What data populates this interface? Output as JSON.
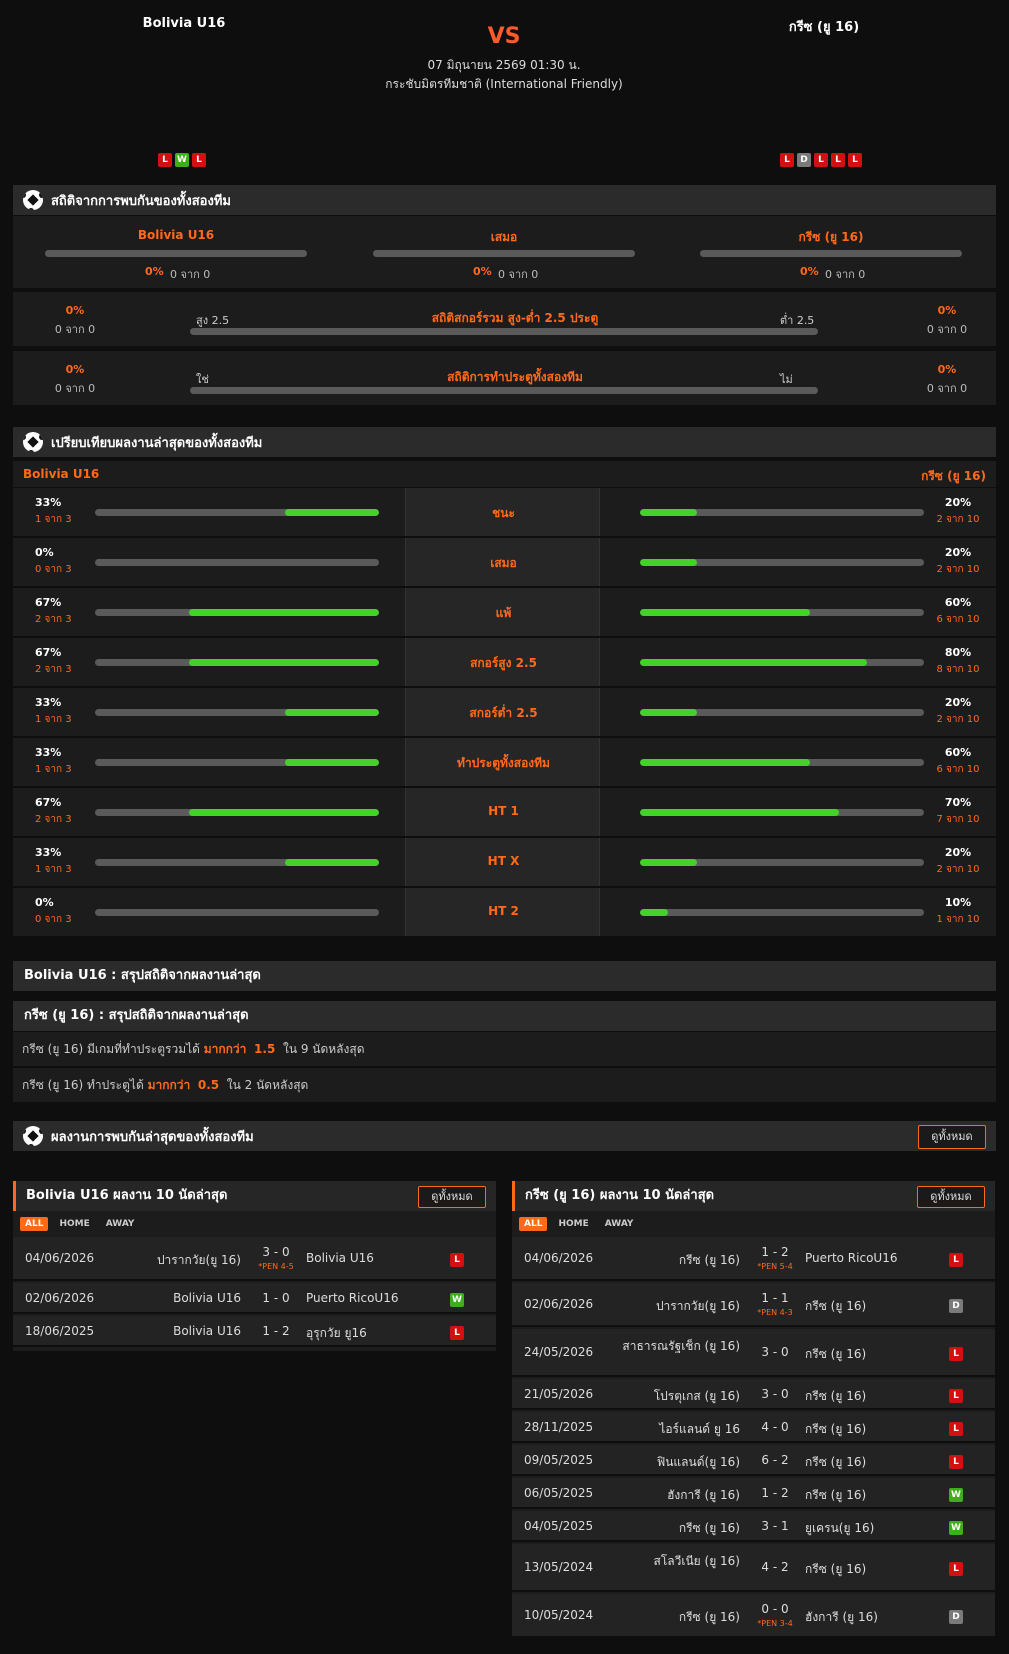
{
  "match": {
    "home_team": "Bolivia U16",
    "away_team": "กรีซ (ยู 16)",
    "vs": "VS",
    "date": "07 มิถุนายน 2569 01:30 น.",
    "league": "กระชับมิตรทีมชาติ (International Friendly)",
    "home_form": [
      "L",
      "W",
      "L"
    ],
    "away_form": [
      "L",
      "D",
      "L",
      "L",
      "L"
    ]
  },
  "h2h_stats": {
    "title": "สถิติจากการพบกันของทั้งสองทีม",
    "cols": [
      {
        "title": "Bolivia U16",
        "pct": "0%",
        "sub": "0 จาก 0"
      },
      {
        "title": "เสมอ",
        "pct": "0%",
        "sub": "0 จาก 0"
      },
      {
        "title": "กรีซ (ยู 16)",
        "pct": "0%",
        "sub": "0 จาก 0"
      }
    ],
    "ou": {
      "left_pct": "0%",
      "left_sub": "0 จาก 0",
      "label_l": "สูง 2.5",
      "title": "สถิติสกอร์รวม สูง-ต่ำ 2.5 ประตู",
      "label_r": "ต่ำ 2.5",
      "right_pct": "0%",
      "right_sub": "0 จาก 0"
    },
    "btts": {
      "left_pct": "0%",
      "left_sub": "0 จาก 0",
      "label_l": "ใช่",
      "title": "สถิติการทำประตูทั้งสองทีม",
      "label_r": "ไม่",
      "right_pct": "0%",
      "right_sub": "0 จาก 0"
    }
  },
  "compare": {
    "title": "เปรียบเทียบผลงานล่าสุดของทั้งสองทีม",
    "home": "Bolivia U16",
    "away": "กรีซ (ยู 16)",
    "rows": [
      {
        "label": "ชนะ",
        "hp": "33%",
        "hs": "1 จาก 3",
        "hf": 0.33,
        "ap": "20%",
        "as": "2 จาก 10",
        "af": 0.2
      },
      {
        "label": "เสมอ",
        "hp": "0%",
        "hs": "0 จาก 3",
        "hf": 0,
        "ap": "20%",
        "as": "2 จาก 10",
        "af": 0.2
      },
      {
        "label": "แพ้",
        "hp": "67%",
        "hs": "2 จาก 3",
        "hf": 0.67,
        "ap": "60%",
        "as": "6 จาก 10",
        "af": 0.6
      },
      {
        "label": "สกอร์สูง 2.5",
        "hp": "67%",
        "hs": "2 จาก 3",
        "hf": 0.67,
        "ap": "80%",
        "as": "8 จาก 10",
        "af": 0.8
      },
      {
        "label": "สกอร์ต่ำ 2.5",
        "hp": "33%",
        "hs": "1 จาก 3",
        "hf": 0.33,
        "ap": "20%",
        "as": "2 จาก 10",
        "af": 0.2
      },
      {
        "label": "ทำประตูทั้งสองทีม",
        "hp": "33%",
        "hs": "1 จาก 3",
        "hf": 0.33,
        "ap": "60%",
        "as": "6 จาก 10",
        "af": 0.6
      },
      {
        "label": "HT 1",
        "hp": "67%",
        "hs": "2 จาก 3",
        "hf": 0.67,
        "ap": "70%",
        "as": "7 จาก 10",
        "af": 0.7
      },
      {
        "label": "HT X",
        "hp": "33%",
        "hs": "1 จาก 3",
        "hf": 0.33,
        "ap": "20%",
        "as": "2 จาก 10",
        "af": 0.2
      },
      {
        "label": "HT 2",
        "hp": "0%",
        "hs": "0 จาก 3",
        "hf": 0,
        "ap": "10%",
        "as": "1 จาก 10",
        "af": 0.1
      }
    ]
  },
  "summary": {
    "home_title": "Bolivia U16 : สรุปสถิติจากผลงานล่าสุด",
    "away_title": "กรีซ (ยู 16) : สรุปสถิติจากผลงานล่าสุด",
    "line1": {
      "pre": "กรีซ (ยู 16)  มีเกมที่ทำประตูรวมได้ ",
      "hl1": "มากกว่า",
      "hl2": "1.5",
      "post": "ใน 9 นัดหลังสุด"
    },
    "line2": {
      "pre": "กรีซ (ยู 16)  ทำประตูได้ ",
      "hl1": "มากกว่า",
      "hl2": "0.5",
      "post": "ใน 2 นัดหลังสุด"
    }
  },
  "recent": {
    "title": "ผลงานการพบกันล่าสุดของทั้งสองทีม",
    "view_all": "ดูทั้งหมด",
    "tabs": [
      "ALL",
      "HOME",
      "AWAY"
    ],
    "home_card": {
      "title": "Bolivia U16 ผลงาน 10 นัดล่าสุด",
      "matches": [
        {
          "date": "04/06/2026",
          "home": "ปารากวัย(ยู 16)",
          "score": "3 - 0",
          "pen": "*PEN 4-5",
          "away": "Bolivia U16",
          "res": "L"
        },
        {
          "date": "02/06/2026",
          "home": "Bolivia U16",
          "score": "1 - 0",
          "pen": "",
          "away": "Puerto RicoU16",
          "res": "W"
        },
        {
          "date": "18/06/2025",
          "home": "Bolivia U16",
          "score": "1 - 2",
          "pen": "",
          "away": "อุรุกวัย ยู16",
          "res": "L"
        }
      ]
    },
    "away_card": {
      "title": "กรีซ (ยู 16) ผลงาน 10 นัดล่าสุด",
      "matches": [
        {
          "date": "04/06/2026",
          "home": "กรีซ (ยู 16)",
          "score": "1 - 2",
          "pen": "*PEN 5-4",
          "away": "Puerto RicoU16",
          "res": "L"
        },
        {
          "date": "02/06/2026",
          "home": "ปารากวัย(ยู 16)",
          "score": "1 - 1",
          "pen": "*PEN 4-3",
          "away": "กรีซ (ยู 16)",
          "res": "D"
        },
        {
          "date": "24/05/2026",
          "home": "สาธารณรัฐเช็ก (ยู 16)",
          "score": "3 - 0",
          "pen": "",
          "away": "กรีซ (ยู 16)",
          "res": "L"
        },
        {
          "date": "21/05/2026",
          "home": "โปรตุเกส (ยู 16)",
          "score": "3 - 0",
          "pen": "",
          "away": "กรีซ (ยู 16)",
          "res": "L"
        },
        {
          "date": "28/11/2025",
          "home": "ไอร์แลนด์ ยู 16",
          "score": "4 - 0",
          "pen": "",
          "away": "กรีซ (ยู 16)",
          "res": "L"
        },
        {
          "date": "09/05/2025",
          "home": "ฟินแลนด์(ยู 16)",
          "score": "6 - 2",
          "pen": "",
          "away": "กรีซ (ยู 16)",
          "res": "L"
        },
        {
          "date": "06/05/2025",
          "home": "ฮังการี (ยู 16)",
          "score": "1 - 2",
          "pen": "",
          "away": "กรีซ (ยู 16)",
          "res": "W"
        },
        {
          "date": "04/05/2025",
          "home": "กรีซ (ยู 16)",
          "score": "3 - 1",
          "pen": "",
          "away": "ยูเครน(ยู 16)",
          "res": "W"
        },
        {
          "date": "13/05/2024",
          "home": "สโลวีเนีย (ยู 16)",
          "score": "4 - 2",
          "pen": "",
          "away": "กรีซ (ยู 16)",
          "res": "L"
        },
        {
          "date": "10/05/2024",
          "home": "กรีซ (ยู 16)",
          "score": "0 - 0",
          "pen": "*PEN 3-4",
          "away": "ฮังการี (ยู 16)",
          "res": "D"
        }
      ]
    }
  }
}
